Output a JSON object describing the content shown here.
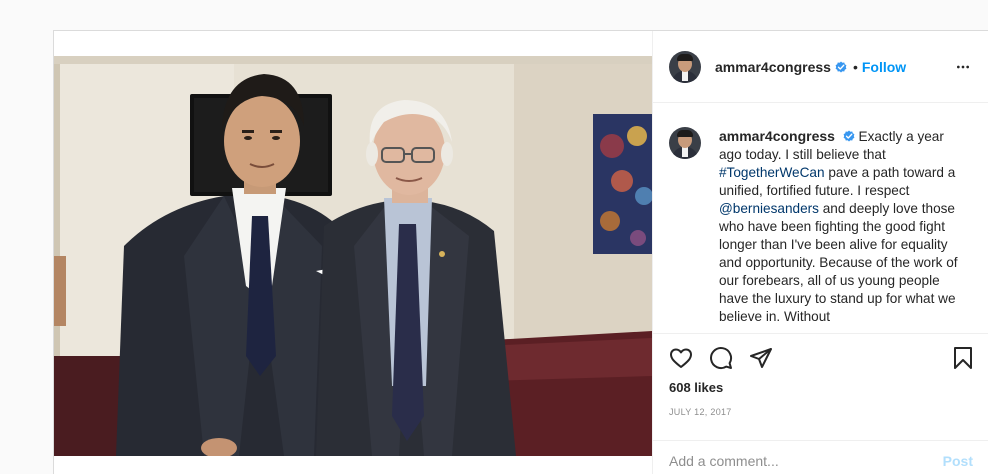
{
  "post": {
    "author": {
      "username": "ammar4congress",
      "verified": true,
      "follow_separator": "•",
      "follow_label": "Follow"
    },
    "caption": {
      "username": "ammar4congress",
      "segments": [
        " Exactly a year ago today. I still believe that ",
        "#TogetherWeCan",
        " pave a path toward a unified, fortified future. I respect ",
        "@berniesanders",
        " and deeply love those who have been fighting the good fight longer than I've been alive for equality and opportunity. Because of the work of our forebears, all of us young people have the luxury to stand up for what we believe in. Without"
      ]
    },
    "likes": "608 likes",
    "date": "JULY 12, 2017",
    "comment": {
      "placeholder": "Add a comment...",
      "post_label": "Post"
    },
    "icons": {
      "like": "heart-icon",
      "comment": "comment-icon",
      "share": "paper-plane-icon",
      "save": "bookmark-icon",
      "more": "more-options-icon",
      "verified": "verified-badge-icon"
    },
    "colors": {
      "accent": "#0095f6",
      "verified": "#3897f0",
      "link": "#00376b",
      "muted": "#8e8e8e",
      "post_disabled": "#b2dffc"
    }
  }
}
